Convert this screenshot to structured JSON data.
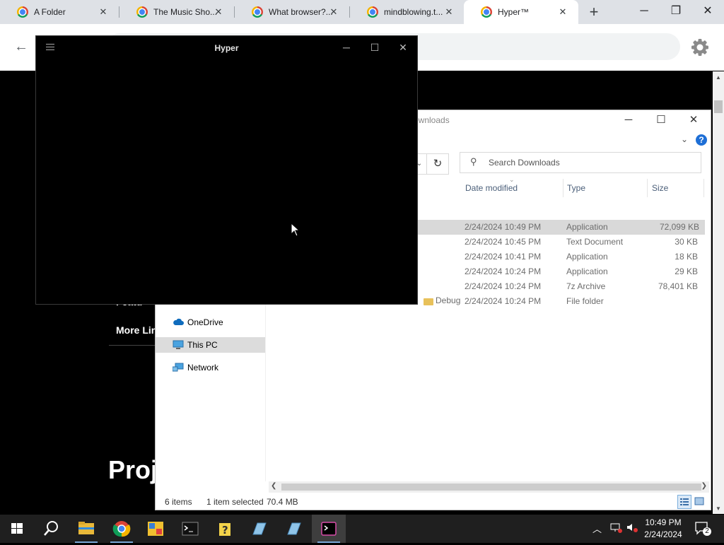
{
  "browser": {
    "tabs": [
      {
        "title": "A Folder"
      },
      {
        "title": "The Music Sho..."
      },
      {
        "title": "What  browser?..."
      },
      {
        "title": "mindblowing.t..."
      },
      {
        "title": "Hyper™"
      }
    ],
    "new_tab_symbol": "+",
    "close_symbol": "✕"
  },
  "webpage": {
    "partial_texts": {
      "feature_fragment": "Featu",
      "more_links": "More Lin",
      "projects_heading": "Proj"
    }
  },
  "explorer": {
    "title_fragment": "ownloads",
    "search_placeholder": "Search Downloads",
    "columns": {
      "date": "Date modified",
      "type": "Type",
      "size": "Size"
    },
    "files": [
      {
        "date": "2/24/2024 10:49 PM",
        "type": "Application",
        "size": "72,099 KB",
        "selected": true
      },
      {
        "date": "2/24/2024 10:45 PM",
        "type": "Text Document",
        "size": "30 KB"
      },
      {
        "date": "2/24/2024 10:41 PM",
        "type": "Application",
        "size": "18 KB"
      },
      {
        "date": "2/24/2024 10:24 PM",
        "type": "Application",
        "size": "29 KB"
      },
      {
        "date": "2/24/2024 10:24 PM",
        "type": "7z Archive",
        "size": "78,401 KB"
      },
      {
        "date": "2/24/2024 10:24 PM",
        "type": "File folder",
        "size": "",
        "name_fragment": "Debug"
      }
    ],
    "nav": [
      {
        "label": "OneDrive",
        "icon": "cloud-icon"
      },
      {
        "label": "This PC",
        "icon": "computer-icon",
        "selected": true
      },
      {
        "label": "Network",
        "icon": "network-icon"
      }
    ],
    "status": {
      "count": "6 items",
      "selection": "1 item selected",
      "size": "70.4 MB"
    }
  },
  "hyper": {
    "title": "Hyper"
  },
  "taskbar": {
    "apps": [
      "start",
      "search",
      "file-explorer",
      "chrome",
      "paint",
      "terminal",
      "help",
      "notepad1",
      "notepad2",
      "hyper"
    ],
    "clock": {
      "time": "10:49 PM",
      "date": "2/24/2024"
    },
    "notification_count": "2"
  },
  "colors": {
    "accent": "#1e6fd6",
    "taskbar": "#1f1f1f",
    "tab_strip": "#dee1e6"
  }
}
